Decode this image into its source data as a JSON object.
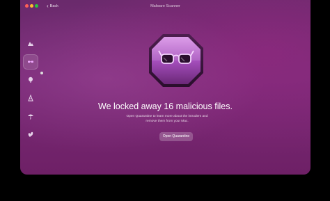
{
  "window": {
    "title": "Malware Scanner",
    "back_label": "Back"
  },
  "sidebar": {
    "items": [
      {
        "icon": "smart-scan-icon"
      },
      {
        "icon": "glasses-icon",
        "active": true
      },
      {
        "icon": "balloon-icon"
      },
      {
        "icon": "performance-icon"
      },
      {
        "icon": "umbrella-icon"
      },
      {
        "icon": "leaves-icon"
      }
    ]
  },
  "main": {
    "headline": "We locked away 16 malicious files.",
    "subtitle": "Open Quarantine to learn more about the intruders and remove them from your Mac.",
    "button_label": "Open Quarantine"
  },
  "colors": {
    "background": "#7a2b78",
    "badge": "#c07ad8",
    "close": "#ff5f57",
    "minimize": "#febc2e",
    "maximize": "#28c840"
  }
}
